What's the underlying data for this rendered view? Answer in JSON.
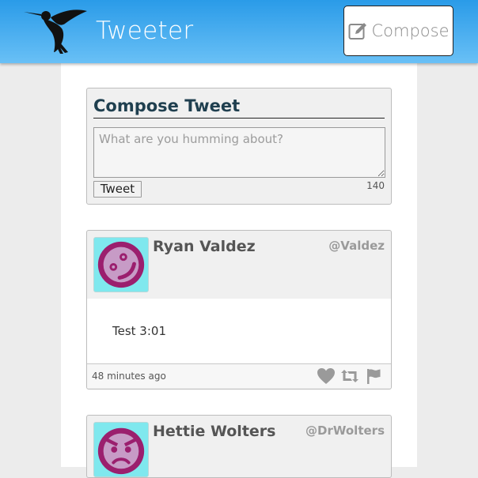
{
  "header": {
    "brand": "Tweeter",
    "compose_label": "Compose",
    "logo_icon": "hummingbird-icon",
    "compose_icon": "pencil-square-icon",
    "gradient_top": "#2a9be8",
    "gradient_bottom": "#69c0f6"
  },
  "compose": {
    "title": "Compose Tweet",
    "placeholder": "What are you humming about?",
    "value": "",
    "button_label": "Tweet",
    "counter": "140"
  },
  "tweets": [
    {
      "name": "Ryan Valdez",
      "handle": "@Valdez",
      "text": "Test 3:01",
      "time": "48 minutes ago",
      "avatar_icon": "smiley-avatar-icon"
    },
    {
      "name": "Hettie Wolters",
      "handle": "@DrWolters",
      "avatar_icon": "angry-avatar-icon"
    }
  ],
  "actions": [
    "heart-icon",
    "retweet-icon",
    "flag-icon"
  ],
  "colors": {
    "avatar_bg": "#7fe8ee",
    "avatar_face": "#9b1f6e",
    "title": "#1f3f4f"
  }
}
